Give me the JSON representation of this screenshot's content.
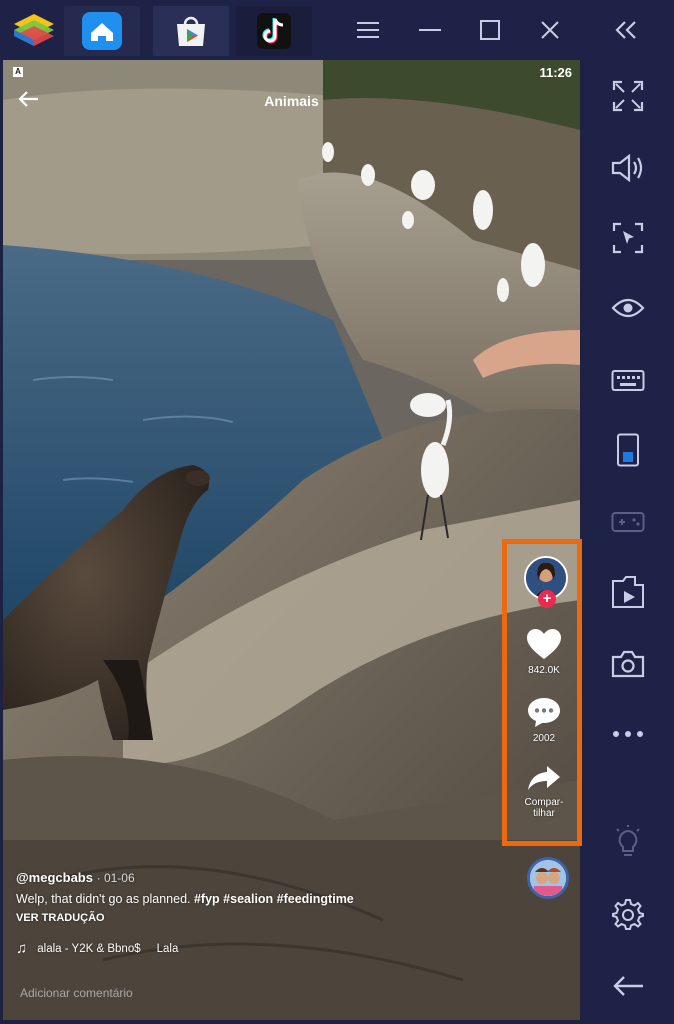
{
  "titlebar": {
    "tabs": [
      {
        "name": "home"
      },
      {
        "name": "play-store"
      },
      {
        "name": "tiktok"
      }
    ]
  },
  "video": {
    "status_time": "11:26",
    "status_badge": "A",
    "page_title": "Animais",
    "username": "@megcbabs",
    "date": "· 01-06",
    "caption_text": "Welp, that didn't go as planned. ",
    "caption_tags": "#fyp #sealion #feedingtime",
    "translate": "VER TRADUÇÃO",
    "music": "alala - Y2K & Bbno$",
    "music_scroll": "Lala",
    "like_count": "842.0K",
    "comment_count": "2002",
    "share_label_1": "Compar-",
    "share_label_2": "tilhar",
    "comment_placeholder": "Adicionar comentário"
  },
  "colors": {
    "chrome": "#1e2246",
    "highlight": "#ea6a12",
    "accent_blue": "#1f7ae0"
  }
}
